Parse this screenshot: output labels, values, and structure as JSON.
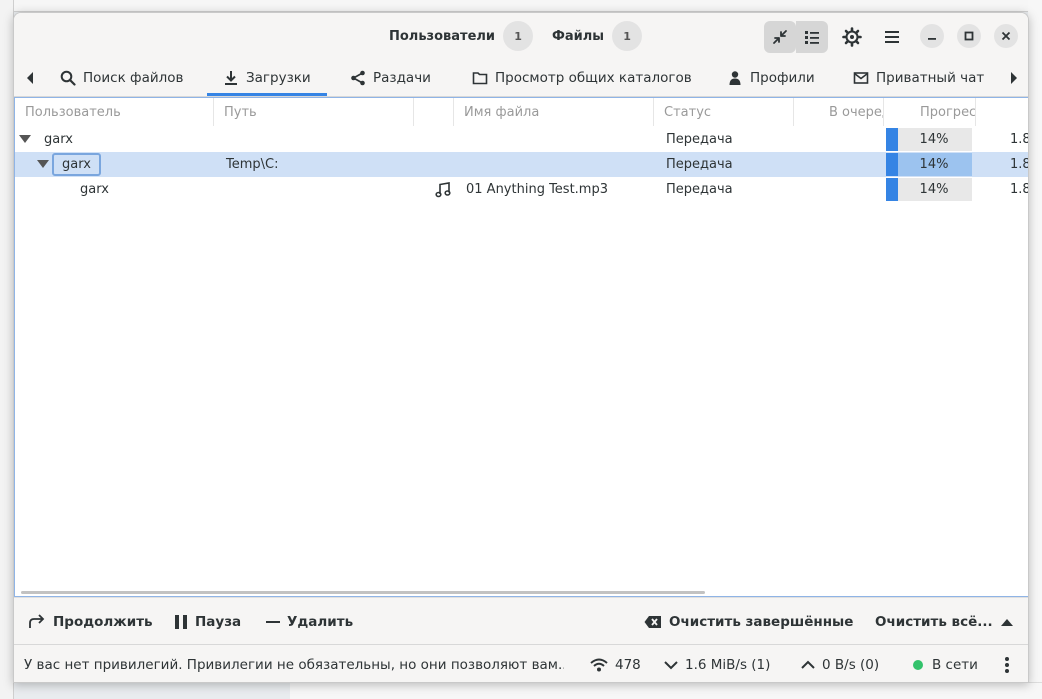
{
  "header": {
    "users_tab": {
      "label": "Пользователи",
      "count": "1"
    },
    "files_tab": {
      "label": "Файлы",
      "count": "1"
    }
  },
  "tabs": {
    "items": [
      {
        "label": "Поиск файлов",
        "icon": "search-icon"
      },
      {
        "label": "Загрузки",
        "icon": "download-icon",
        "active": true
      },
      {
        "label": "Раздачи",
        "icon": "share-icon"
      },
      {
        "label": "Просмотр общих каталогов",
        "icon": "folder-icon"
      },
      {
        "label": "Профили",
        "icon": "person-icon"
      },
      {
        "label": "Приватный чат",
        "icon": "mail-icon"
      }
    ]
  },
  "table": {
    "columns": [
      "Пользователь",
      "Путь",
      "Имя файла",
      "Статус",
      "В очереди",
      "Прогресс"
    ],
    "rows": [
      {
        "user": "garx",
        "path": "",
        "filename": "",
        "status": "Передача",
        "progress": 14,
        "progress_label": "14%",
        "size": "1.8"
      },
      {
        "user": "garx",
        "path": "Temp\\C:",
        "filename": "",
        "status": "Передача",
        "progress": 14,
        "progress_label": "14%",
        "size": "1.8"
      },
      {
        "user": "garx",
        "path": "",
        "filename": "01 Anything Test.mp3",
        "status": "Передача",
        "progress": 14,
        "progress_label": "14%",
        "size": "1.8"
      }
    ]
  },
  "actions": {
    "resume": "Продолжить",
    "pause": "Пауза",
    "remove": "Удалить",
    "clear_finished": "Очистить завершённые",
    "clear_all": "Очистить всё..."
  },
  "status": {
    "message": "У вас нет привилегий. Привилегии не обязательны, но они позволяют вам...",
    "connections": "478",
    "download_speed": "1.6 MiB/s (1)",
    "upload_speed": "0 B/s (0)",
    "online": "В сети"
  },
  "colors": {
    "accent": "#3584e4",
    "online": "#33c26b",
    "selection": "#cfe0f6"
  }
}
